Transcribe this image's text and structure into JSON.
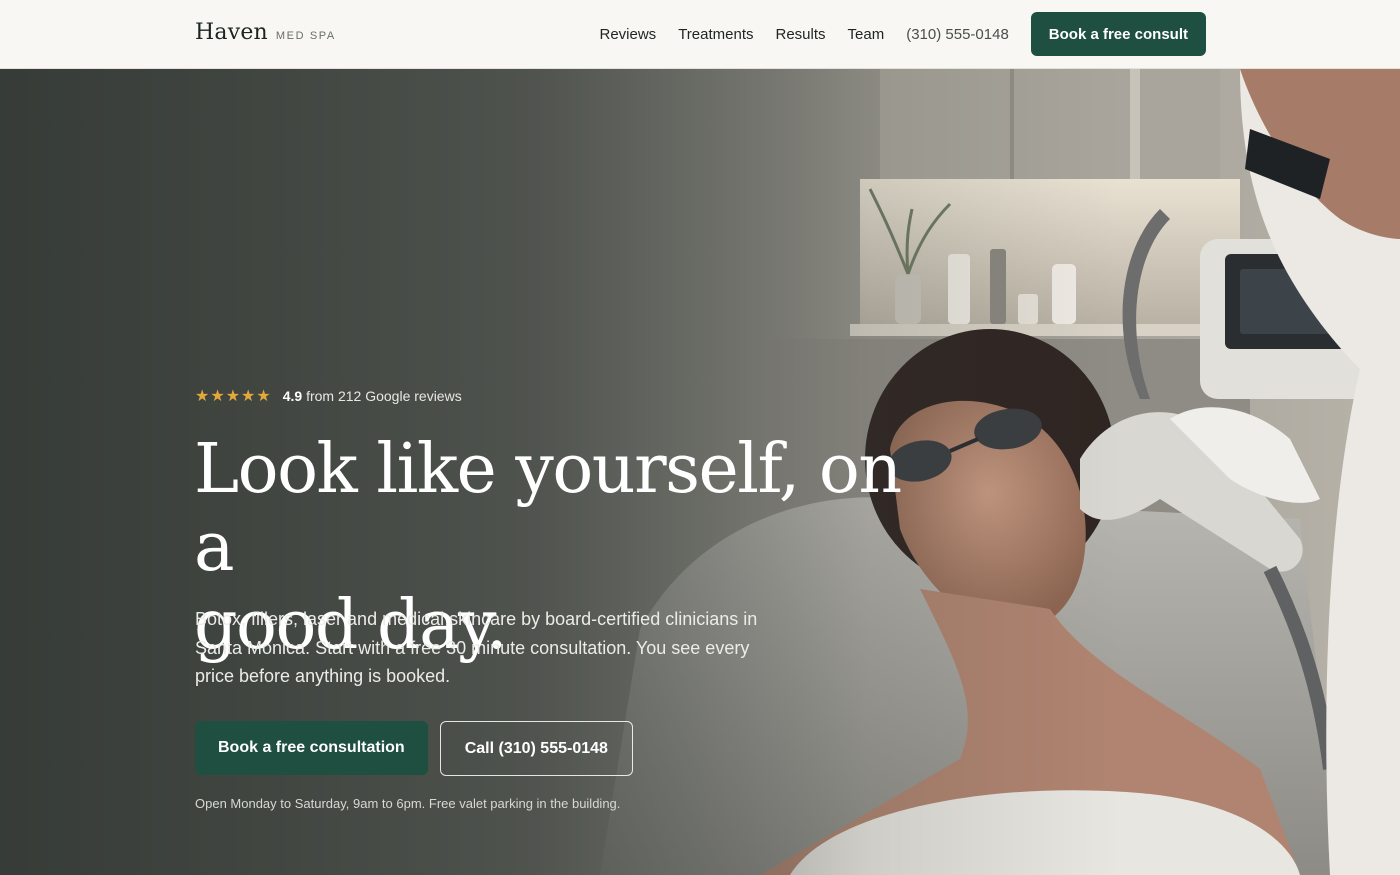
{
  "nav": {
    "brand_name": "Haven",
    "brand_sub": "MED SPA",
    "links": [
      "Reviews",
      "Treatments",
      "Results",
      "Team"
    ],
    "phone": "(310) 555-0148",
    "cta_label": "Book a free consult"
  },
  "hero": {
    "rating_score": "4.9",
    "rating_text": "from 212 Google reviews",
    "stars": 5,
    "headline_line1": "Look like yourself, on a",
    "headline_line2": "good day.",
    "subcopy": "Botox, fillers, laser and medical skincare by board-certified clinicians in Santa Monica. Start with a free 30 minute consultation. You see every price before anything is booked.",
    "primary_cta": "Book a free consultation",
    "secondary_cta": "Call (310) 555-0148",
    "hours_note": "Open Monday to Saturday, 9am to 6pm. Free valet parking in the building."
  },
  "colors": {
    "brand_green": "#1e4f40",
    "star_gold": "#e3a83b",
    "nav_bg": "#f8f7f3"
  },
  "icons": [
    "star-icon"
  ]
}
